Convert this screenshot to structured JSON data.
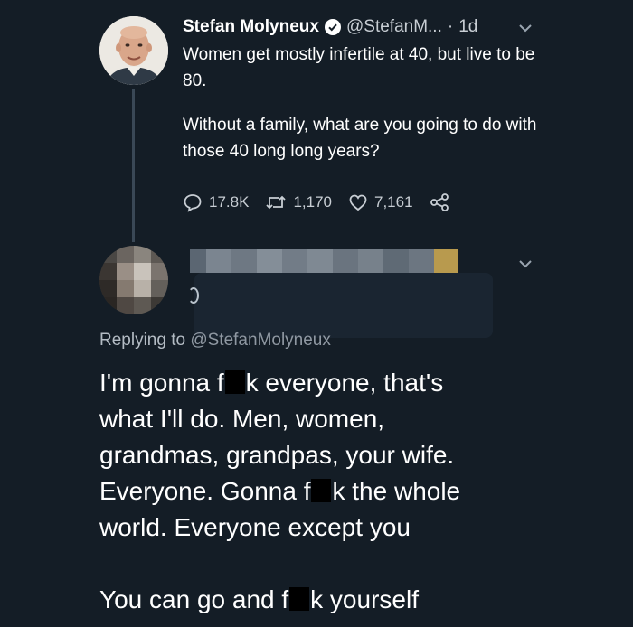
{
  "tweet": {
    "author_name": "Stefan Molyneux",
    "handle": "@StefanM...",
    "separator": "·",
    "time": "1d",
    "paragraphs": [
      "Women get mostly infertile at 40, but live to be 80.",
      "Without a family, what are you going to do with those 40 long long years?"
    ],
    "replies_count": "17.8K",
    "retweets_count": "1,170",
    "likes_count": "7,161"
  },
  "reply": {
    "replying_prefix": "Replying to",
    "replying_handle": "@StefanMolyneux",
    "line1_a": "I'm gonna f",
    "line1_b": "k everyone, that's",
    "line2": "what I'll do. Men, women,",
    "line3": "grandmas, grandpas, your wife.",
    "line4_a": "Everyone. Gonna f",
    "line4_b": "k the whole",
    "line5": "world. Everyone except you",
    "line6_a": "You can go and f",
    "line6_b": "k yourself"
  },
  "colors": {
    "background": "#141d26",
    "text_primary": "#ffffff",
    "text_secondary": "#c8ced4",
    "thread_line": "#3a4856"
  },
  "icons": {
    "verified": "verified-badge-icon",
    "caret": "chevron-down-icon",
    "reply": "comment-icon",
    "retweet": "retweet-icon",
    "like": "heart-icon",
    "share": "share-icon"
  }
}
